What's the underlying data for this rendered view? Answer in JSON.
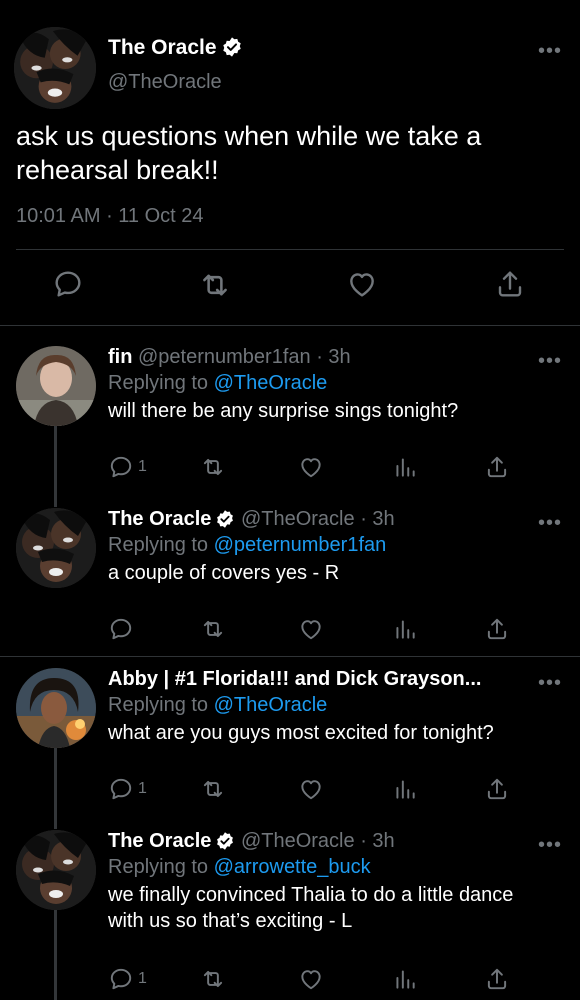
{
  "main_tweet": {
    "name": "The Oracle",
    "handle": "@TheOracle",
    "text": "ask us questions when while we take a rehearsal break!!",
    "time": "10:01 AM",
    "date": "11 Oct 24",
    "more": "•••"
  },
  "replies": [
    {
      "name": "fin",
      "handle": "@peternumber1fan",
      "age": "· 3h",
      "replying_label": "Replying to",
      "replying_to": "@TheOracle",
      "text": "will there be any surprise sings tonight?",
      "reply_count": "1",
      "more": "•••"
    },
    {
      "name": "The Oracle",
      "handle": "@TheOracle",
      "age": "· 3h",
      "replying_label": "Replying to",
      "replying_to": "@peternumber1fan",
      "text": "a couple of covers yes - R",
      "reply_count": "",
      "more": "•••"
    },
    {
      "name": "Abby | #1 Florida!!! and Dick Grayson...",
      "handle": "",
      "age": "",
      "replying_label": "Replying to",
      "replying_to": "@TheOracle",
      "text": "what are you guys most excited for tonight?",
      "reply_count": "1",
      "more": "•••"
    },
    {
      "name": "The Oracle",
      "handle": "@TheOracle",
      "age": "· 3h",
      "replying_label": "Replying to",
      "replying_to": "@arrowette_buck",
      "text": "we finally convinced Thalia to do a little dance with us so that’s exciting - L",
      "reply_count": "1",
      "more": "•••"
    }
  ],
  "colors": {
    "background": "#000000",
    "text": "#e7e9ea",
    "muted": "#71767b",
    "link": "#1d9bf0",
    "verified": "#ffffff"
  }
}
